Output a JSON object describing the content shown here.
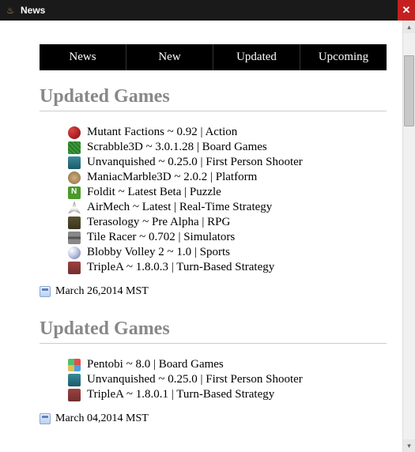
{
  "window": {
    "title": "News"
  },
  "tabs": [
    "News",
    "New",
    "Updated",
    "Upcoming"
  ],
  "sections": [
    {
      "title": "Updated Games",
      "games": [
        {
          "text": "Mutant Factions ~ 0.92 | Action",
          "icon": "ic-red"
        },
        {
          "text": "Scrabble3D ~ 3.0.1.28 | Board Games",
          "icon": "ic-green"
        },
        {
          "text": "Unvanquished ~ 0.25.0 | First Person Shooter",
          "icon": "ic-teal"
        },
        {
          "text": "ManiacMarble3D ~ 2.0.2 | Platform",
          "icon": "ic-brown"
        },
        {
          "text": "Foldit ~ Latest Beta | Puzzle",
          "icon": "ic-lime"
        },
        {
          "text": "AirMech ~ Latest | Real-Time Strategy",
          "icon": "ic-rocket"
        },
        {
          "text": "Terasology ~ Pre Alpha | RPG",
          "icon": "ic-dark"
        },
        {
          "text": "Tile Racer ~ 0.702 | Simulators",
          "icon": "ic-road"
        },
        {
          "text": "Blobby Volley 2 ~ 1.0 | Sports",
          "icon": "ic-ball"
        },
        {
          "text": "TripleA ~ 1.8.0.3 | Turn-Based Strategy",
          "icon": "ic-army"
        }
      ],
      "date": "March 26,2014 MST"
    },
    {
      "title": "Updated Games",
      "games": [
        {
          "text": "Pentobi ~ 8.0 | Board Games",
          "icon": "ic-multi"
        },
        {
          "text": "Unvanquished ~ 0.25.0 | First Person Shooter",
          "icon": "ic-teal"
        },
        {
          "text": "TripleA ~ 1.8.0.1 | Turn-Based Strategy",
          "icon": "ic-army"
        }
      ],
      "date": "March 04,2014 MST"
    }
  ]
}
